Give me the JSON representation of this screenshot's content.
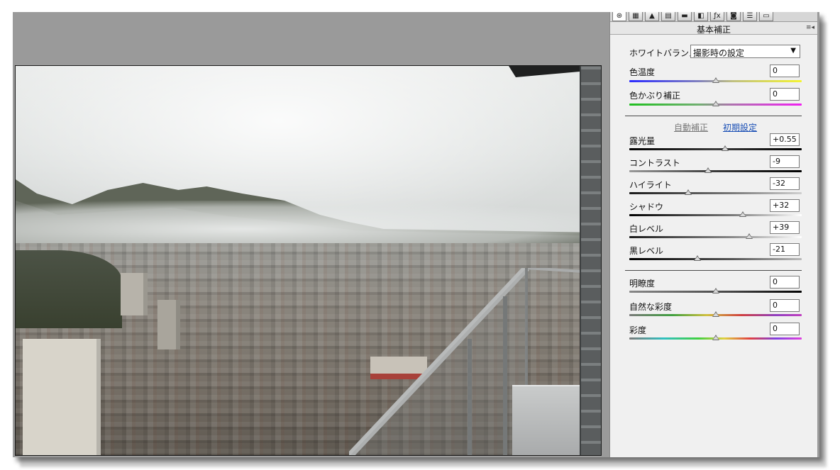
{
  "colors": {
    "panel_bg": "#f0f0f0",
    "workspace_bg": "#9a9a9a",
    "link": "#1a4fb5",
    "link_disabled": "#7a7a7a"
  },
  "tabs": [
    "basic-icon",
    "tone-curve-icon",
    "detail-icon",
    "hsl-icon",
    "split-toning-icon",
    "lens-corrections-icon",
    "effects-icon",
    "camera-calibration-icon",
    "presets-icon",
    "snapshots-icon"
  ],
  "panel": {
    "title": "基本補正",
    "white_balance": {
      "label": "ホワイトバランス：",
      "value": "撮影時の設定"
    },
    "temp": {
      "label": "色温度",
      "value": "0",
      "pos": 0.5
    },
    "tint": {
      "label": "色かぶり補正",
      "value": "0",
      "pos": 0.5
    },
    "auto_label": "自動補正",
    "default_label": "初期設定",
    "tone": [
      {
        "label": "露光量",
        "value": "+0.55",
        "pos": 0.555
      },
      {
        "label": "コントラスト",
        "value": "-9",
        "pos": 0.455
      },
      {
        "label": "ハイライト",
        "value": "-32",
        "pos": 0.34
      },
      {
        "label": "シャドウ",
        "value": "+32",
        "pos": 0.66
      },
      {
        "label": "白レベル",
        "value": "+39",
        "pos": 0.695
      },
      {
        "label": "黒レベル",
        "value": "-21",
        "pos": 0.395
      }
    ],
    "presence": [
      {
        "label": "明瞭度",
        "value": "0",
        "pos": 0.5
      },
      {
        "label": "自然な彩度",
        "value": "0",
        "pos": 0.5
      },
      {
        "label": "彩度",
        "value": "0",
        "pos": 0.5
      }
    ]
  }
}
